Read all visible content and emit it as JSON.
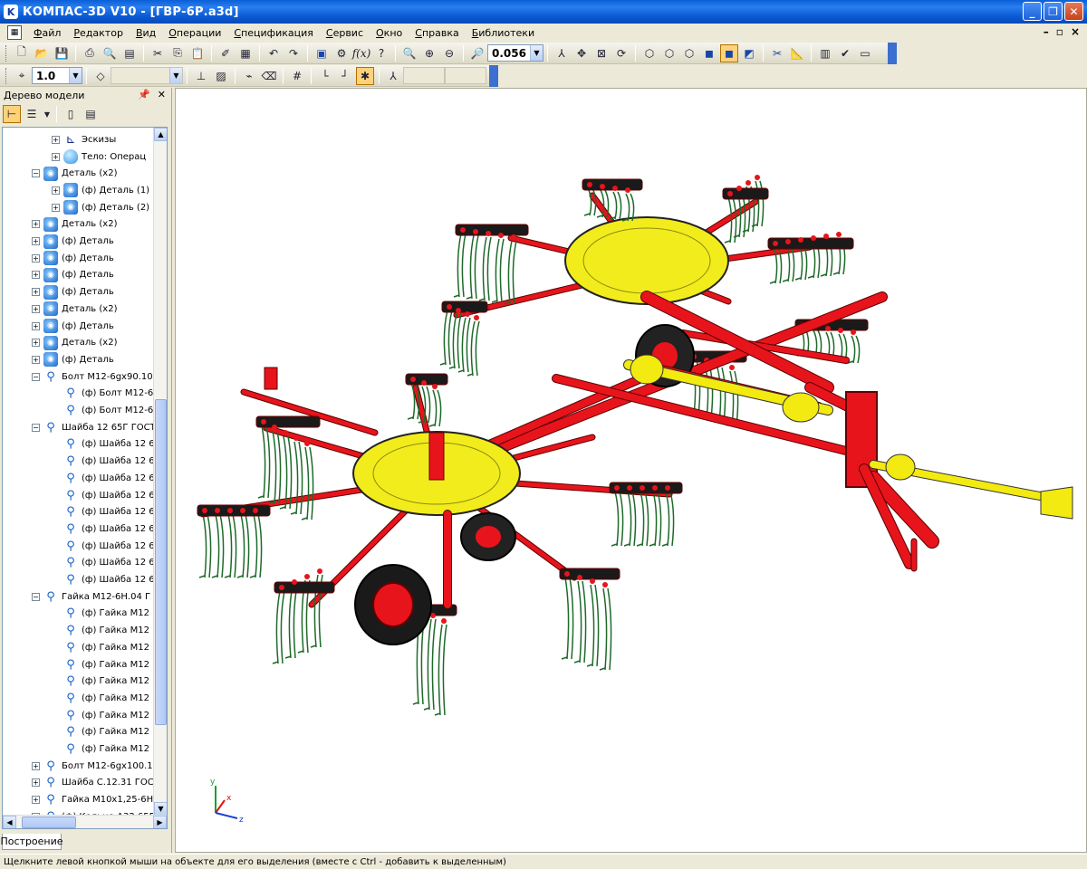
{
  "window": {
    "title": "КОМПАС-3D V10 - [ГВР-6Р.a3d]",
    "accent_color": "#0a5fd8",
    "buttons": [
      "minimize-icon",
      "restore-icon",
      "close-icon"
    ]
  },
  "menu": {
    "items": [
      "Файл",
      "Редактор",
      "Вид",
      "Операции",
      "Спецификация",
      "Сервис",
      "Окно",
      "Справка",
      "Библиотеки"
    ]
  },
  "toolbar_main": {
    "zoom_value": "0.056"
  },
  "toolbar_secondary": {
    "step_value": "1.0"
  },
  "model_tree": {
    "title": "Дерево модели",
    "tab_label": "Построение",
    "rows": [
      {
        "level": 2,
        "expander": "+",
        "icon": "sketch-icon",
        "label": "Эскизы"
      },
      {
        "level": 2,
        "expander": "+",
        "icon": "body-icon",
        "label": "Тело: Операц"
      },
      {
        "level": 1,
        "expander": "−",
        "icon": "part-icon",
        "label": "Деталь (x2)"
      },
      {
        "level": 2,
        "expander": "+",
        "icon": "part-icon",
        "label": "(ф) Деталь (1)"
      },
      {
        "level": 2,
        "expander": "+",
        "icon": "part-icon",
        "label": "(ф) Деталь (2)"
      },
      {
        "level": 1,
        "expander": "+",
        "icon": "part-icon",
        "label": "Деталь (x2)"
      },
      {
        "level": 1,
        "expander": "+",
        "icon": "part-icon",
        "label": "(ф) Деталь"
      },
      {
        "level": 1,
        "expander": "+",
        "icon": "part-icon",
        "label": "(ф) Деталь"
      },
      {
        "level": 1,
        "expander": "+",
        "icon": "part-icon",
        "label": "(ф) Деталь"
      },
      {
        "level": 1,
        "expander": "+",
        "icon": "part-icon",
        "label": "(ф) Деталь"
      },
      {
        "level": 1,
        "expander": "+",
        "icon": "part-icon",
        "label": "Деталь (x2)"
      },
      {
        "level": 1,
        "expander": "+",
        "icon": "part-icon",
        "label": "(ф) Деталь"
      },
      {
        "level": 1,
        "expander": "+",
        "icon": "part-icon",
        "label": "Деталь (x2)"
      },
      {
        "level": 1,
        "expander": "+",
        "icon": "part-icon",
        "label": "(ф) Деталь"
      },
      {
        "level": 1,
        "expander": "−",
        "icon": "bolt-icon",
        "label": "Болт М12-6gx90.10"
      },
      {
        "level": 2,
        "expander": "",
        "icon": "bolt-icon",
        "label": "(ф) Болт М12-6"
      },
      {
        "level": 2,
        "expander": "",
        "icon": "bolt-icon",
        "label": "(ф) Болт М12-6"
      },
      {
        "level": 1,
        "expander": "−",
        "icon": "bolt-icon",
        "label": "Шайба 12 65Г ГОСТ"
      },
      {
        "level": 2,
        "expander": "",
        "icon": "bolt-icon",
        "label": "(ф) Шайба 12 6"
      },
      {
        "level": 2,
        "expander": "",
        "icon": "bolt-icon",
        "label": "(ф) Шайба 12 6"
      },
      {
        "level": 2,
        "expander": "",
        "icon": "bolt-icon",
        "label": "(ф) Шайба 12 6"
      },
      {
        "level": 2,
        "expander": "",
        "icon": "bolt-icon",
        "label": "(ф) Шайба 12 6"
      },
      {
        "level": 2,
        "expander": "",
        "icon": "bolt-icon",
        "label": "(ф) Шайба 12 6"
      },
      {
        "level": 2,
        "expander": "",
        "icon": "bolt-icon",
        "label": "(ф) Шайба 12 6"
      },
      {
        "level": 2,
        "expander": "",
        "icon": "bolt-icon",
        "label": "(ф) Шайба 12 6"
      },
      {
        "level": 2,
        "expander": "",
        "icon": "bolt-icon",
        "label": "(ф) Шайба 12 6"
      },
      {
        "level": 2,
        "expander": "",
        "icon": "bolt-icon",
        "label": "(ф) Шайба 12 6"
      },
      {
        "level": 1,
        "expander": "−",
        "icon": "bolt-icon",
        "label": "Гайка М12-6Н.04 Г"
      },
      {
        "level": 2,
        "expander": "",
        "icon": "bolt-icon",
        "label": "(ф) Гайка М12"
      },
      {
        "level": 2,
        "expander": "",
        "icon": "bolt-icon",
        "label": "(ф) Гайка М12"
      },
      {
        "level": 2,
        "expander": "",
        "icon": "bolt-icon",
        "label": "(ф) Гайка М12"
      },
      {
        "level": 2,
        "expander": "",
        "icon": "bolt-icon",
        "label": "(ф) Гайка М12"
      },
      {
        "level": 2,
        "expander": "",
        "icon": "bolt-icon",
        "label": "(ф) Гайка М12"
      },
      {
        "level": 2,
        "expander": "",
        "icon": "bolt-icon",
        "label": "(ф) Гайка М12"
      },
      {
        "level": 2,
        "expander": "",
        "icon": "bolt-icon",
        "label": "(ф) Гайка М12"
      },
      {
        "level": 2,
        "expander": "",
        "icon": "bolt-icon",
        "label": "(ф) Гайка М12"
      },
      {
        "level": 2,
        "expander": "",
        "icon": "bolt-icon",
        "label": "(ф) Гайка М12"
      },
      {
        "level": 1,
        "expander": "+",
        "icon": "bolt-icon",
        "label": "Болт М12-6gx100.1"
      },
      {
        "level": 1,
        "expander": "+",
        "icon": "bolt-icon",
        "label": "Шайба С.12.31 ГОС"
      },
      {
        "level": 1,
        "expander": "+",
        "icon": "bolt-icon",
        "label": "Гайка М10х1,25-6Н"
      },
      {
        "level": 1,
        "expander": "+",
        "icon": "bolt-icon",
        "label": "(ф) Кольцо А32.65Г"
      }
    ]
  },
  "viewport": {
    "model_colors": {
      "frame": "#e8141c",
      "rotor": "#f2ec1c",
      "tines": "#1e6a2a",
      "shaft": "#f2ea10"
    },
    "axis_labels": {
      "x": "x",
      "y": "y",
      "z": "z"
    }
  },
  "statusbar": {
    "message": "Щелкните левой кнопкой мыши на объекте для его выделения (вместе с Ctrl - добавить к выделенным)"
  }
}
